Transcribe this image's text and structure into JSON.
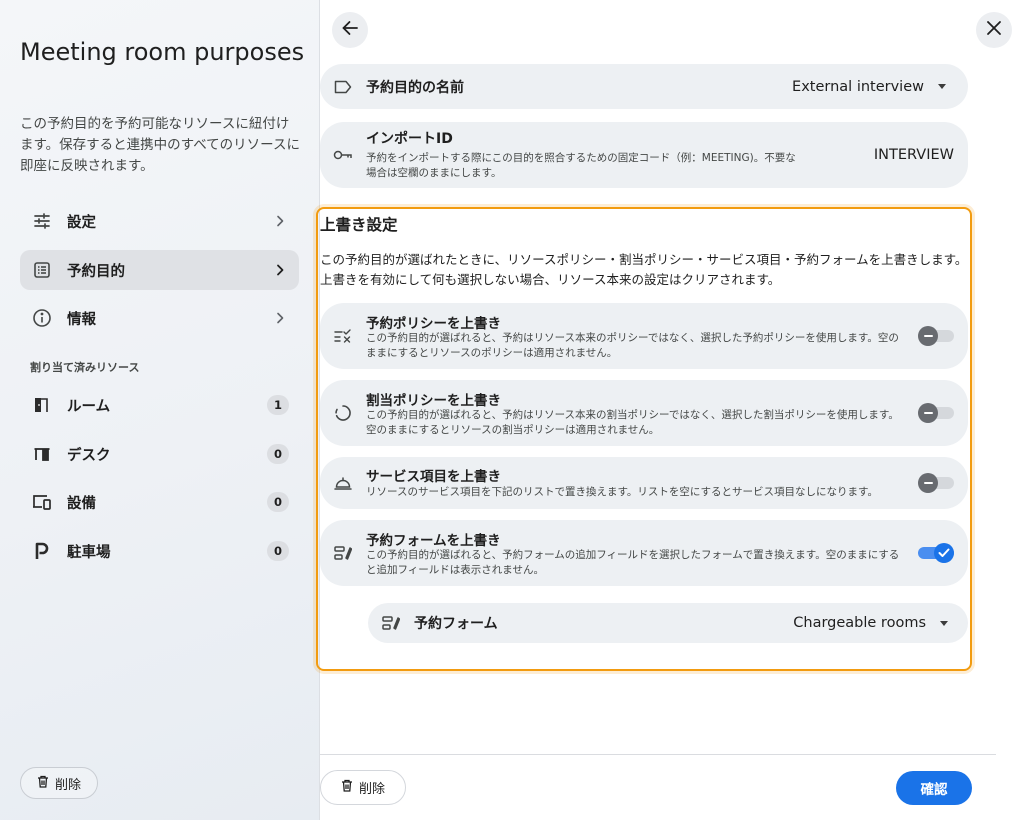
{
  "sidebar": {
    "title": "Meeting room purposes",
    "description": "この予約目的を予約可能なリソースに紐付けます。保存すると連携中のすべてのリソースに即座に反映されます。",
    "nav": [
      {
        "label": "設定",
        "icon": "sliders-icon",
        "active": false
      },
      {
        "label": "予約目的",
        "icon": "list-icon",
        "active": true
      },
      {
        "label": "情報",
        "icon": "info-icon",
        "active": false
      }
    ],
    "section_label": "割り当て済みリソース",
    "resources": [
      {
        "label": "ルーム",
        "count": "1",
        "icon": "room-door-icon"
      },
      {
        "label": "デスク",
        "count": "0",
        "icon": "desk-icon"
      },
      {
        "label": "設備",
        "count": "0",
        "icon": "devices-icon"
      },
      {
        "label": "駐車場",
        "count": "0",
        "icon": "parking-icon"
      }
    ],
    "delete_label": "削除"
  },
  "header": {
    "back_icon": "arrow-left-icon",
    "close_icon": "close-icon"
  },
  "fields": {
    "purpose_name": {
      "label": "予約目的の名前",
      "value": "External interview",
      "icon": "label-tag-icon"
    },
    "import_id": {
      "label": "インポートID",
      "help": "予約をインポートする際にこの目的を照合するための固定コード（例：MEETING)。不要な場合は空欄のままにします。",
      "value": "INTERVIEW",
      "icon": "key-icon"
    }
  },
  "overrides": {
    "title": "上書き設定",
    "description": "この予約目的が選ばれたときに、リソースポリシー・割当ポリシー・サービス項目・予約フォームを上書きします。上書きを有効にして何も選択しない場合、リソース本来の設定はクリアされます。",
    "items": [
      {
        "title": "予約ポリシーを上書き",
        "desc": "この予約目的が選ばれると、予約はリソース本来のポリシーではなく、選択した予約ポリシーを使用します。空のままにするとリソースのポリシーは適用されません。",
        "icon": "rule-check-icon",
        "enabled": false
      },
      {
        "title": "割当ポリシーを上書き",
        "desc": "この予約目的が選ばれると、予約はリソース本来の割当ポリシーではなく、選択した割当ポリシーを使用します。空のままにするとリソースの割当ポリシーは適用されません。",
        "icon": "circle-dashed-icon",
        "enabled": false
      },
      {
        "title": "サービス項目を上書き",
        "desc": "リソースのサービス項目を下記のリストで置き換えます。リストを空にするとサービス項目なしになります。",
        "icon": "service-bell-icon",
        "enabled": false
      },
      {
        "title": "予約フォームを上書き",
        "desc": "この予約目的が選ばれると、予約フォームの追加フィールドを選択したフォームで置き換えます。空のままにすると追加フィールドは表示されません。",
        "icon": "form-edit-icon",
        "enabled": true
      }
    ],
    "form_select": {
      "label": "予約フォーム",
      "value": "Chargeable rooms",
      "icon": "form-edit-icon"
    }
  },
  "footer": {
    "delete_label": "削除",
    "confirm_label": "確認"
  },
  "colors": {
    "accent": "#1a73e8",
    "highlight": "#f29b0f"
  }
}
